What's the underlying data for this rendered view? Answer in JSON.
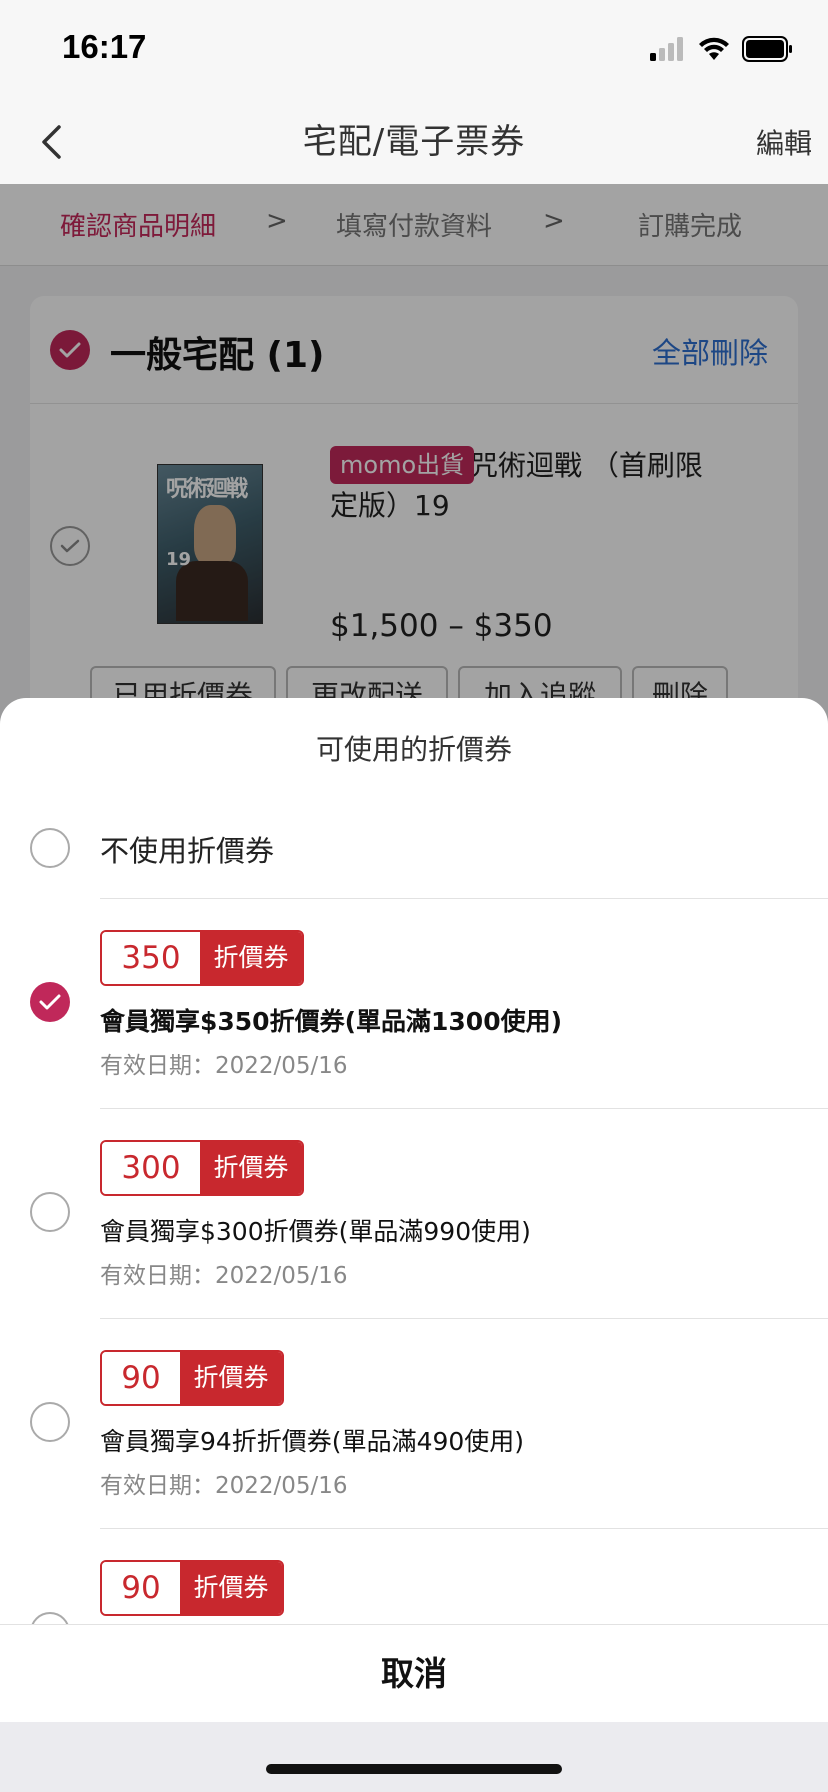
{
  "status_bar": {
    "time": "16:17"
  },
  "nav": {
    "title": "宅配/電子票券",
    "edit_label": "編輯"
  },
  "steps": [
    {
      "label": "確認商品明細"
    },
    {
      "label": "填寫付款資料"
    },
    {
      "label": "訂購完成"
    }
  ],
  "step_separator": ">",
  "cart": {
    "title": "一般宅配 (1)",
    "delete_all_label": "全部刪除",
    "item": {
      "tag": "momo出貨",
      "name": "咒術迴戰 （首刷限定版）19",
      "price": "$1,500 – $350",
      "cover_title": "呪術廻戦",
      "cover_number": "19"
    },
    "actions": [
      "已用折價券",
      "更改配送",
      "加入追蹤",
      "刪除"
    ]
  },
  "sheet": {
    "title": "可使用的折價券",
    "no_coupon_label": "不使用折價券",
    "coupons": [
      {
        "amount": "350",
        "type": "折價券",
        "name": "會員獨享$350折價券(單品滿1300使用)",
        "date": "有效日期：2022/05/16",
        "selected": true
      },
      {
        "amount": "300",
        "type": "折價券",
        "name": "會員獨享$300折價券(單品滿990使用)",
        "date": "有效日期：2022/05/16",
        "selected": false
      },
      {
        "amount": "90",
        "type": "折價券",
        "name": "會員獨享94折折價券(單品滿490使用)",
        "date": "有效日期：2022/05/16",
        "selected": false
      },
      {
        "amount": "90",
        "type": "折價券",
        "name": "",
        "date": "",
        "selected": false
      }
    ],
    "cancel_label": "取消"
  },
  "colors": {
    "accent": "#c0285a",
    "coupon_red": "#c8282e",
    "link_blue": "#2e6fd0"
  }
}
